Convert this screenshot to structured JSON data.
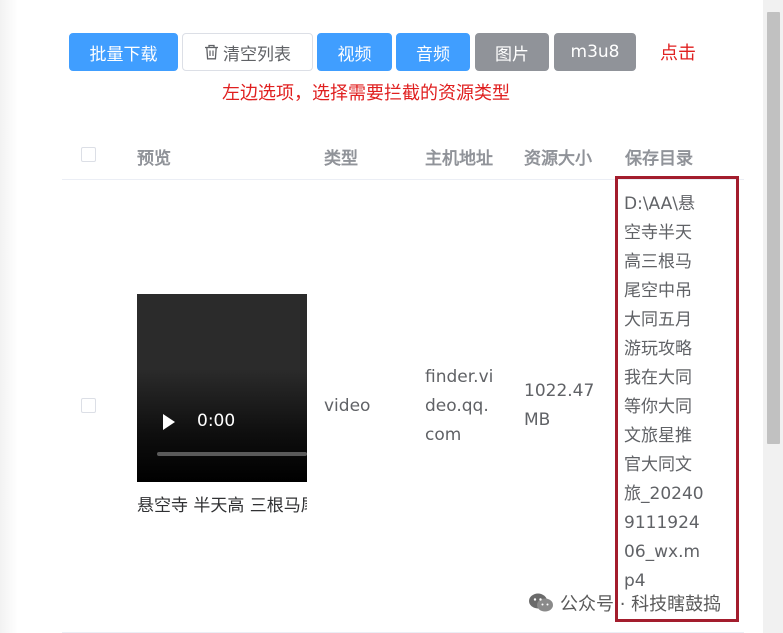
{
  "toolbar": {
    "batch_download": "批量下载",
    "clear_list": "清空列表",
    "video": "视频",
    "audio": "音频",
    "image": "图片",
    "m3u8": "m3u8"
  },
  "hints": {
    "click": "点击",
    "choose_type": "左边选项，选择需要拦截的资源类型"
  },
  "table": {
    "headers": {
      "preview": "预览",
      "type": "类型",
      "host": "主机地址",
      "size": "资源大小",
      "save_dir": "保存目录"
    },
    "row": {
      "type": "video",
      "host": "finder.video.qq.com",
      "size": "1022.47 MB",
      "save_dir": "D:\\AA\\悬空寺半天高三根马尾空中吊大同五月游玩攻略我在大同等你大同文旅星推官大同文旅_20240911192406_wx.mp4",
      "video_time": "0:00",
      "caption": "悬空寺 半天高 三根马尾空中吊"
    }
  },
  "watermark": "公众号 · 科技瞎鼓捣",
  "colors": {
    "primary": "#409eff",
    "info": "#909399",
    "hint_red": "#e02020",
    "highlight_box": "#a31d2d"
  }
}
